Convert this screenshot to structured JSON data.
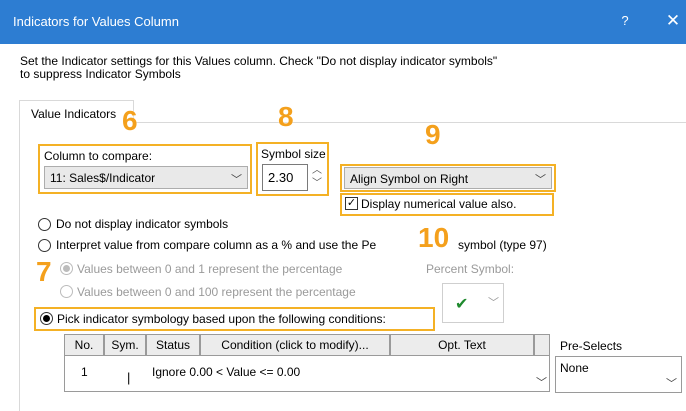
{
  "window": {
    "title": "Indicators for Values Column",
    "help": "?",
    "close": "✕"
  },
  "instructions": {
    "line1": "Set the Indicator settings for this Values column. Check \"Do not display indicator symbols\"",
    "line2": "to suppress Indicator Symbols"
  },
  "tab": {
    "label": "Value Indicators"
  },
  "callouts": {
    "n6": "6",
    "n7": "7",
    "n8": "8",
    "n9": "9",
    "n10": "10"
  },
  "compare": {
    "label": "Column to compare:",
    "value": "11: Sales$/Indicator"
  },
  "symbol_size": {
    "label": "Symbol size",
    "value": "2.30"
  },
  "align": {
    "value": "Align Symbol on Right"
  },
  "display_numerical": {
    "label": "Display numerical value also.",
    "checked": true
  },
  "options": {
    "no_display": "Do not display indicator symbols",
    "interpret": "Interpret value from compare column as a % and use the Pe",
    "interpret_tail": "symbol (type 97)",
    "range_0_1": "Values between 0 and 1 represent the percentage",
    "range_0_100": "Values between 0 and 100 represent the percentage",
    "pick": "Pick indicator symbology based upon the following conditions:"
  },
  "percent_symbol": {
    "label": "Percent Symbol:",
    "glyph": "✔",
    "glyph_color": "#1f8a2e"
  },
  "grid": {
    "headers": [
      "No.",
      "Sym.",
      "Status",
      "Condition (click to modify)...",
      "Opt. Text"
    ],
    "rows": [
      {
        "no": "1",
        "sym": "|",
        "condition": "Ignore 0.00 < Value <= 0.00"
      }
    ]
  },
  "preselects": {
    "label": "Pre-Selects",
    "value": "None"
  },
  "colors": {
    "titlebar": "#2d7dd2",
    "highlight": "#f4b125",
    "callout": "#f4a01c"
  }
}
